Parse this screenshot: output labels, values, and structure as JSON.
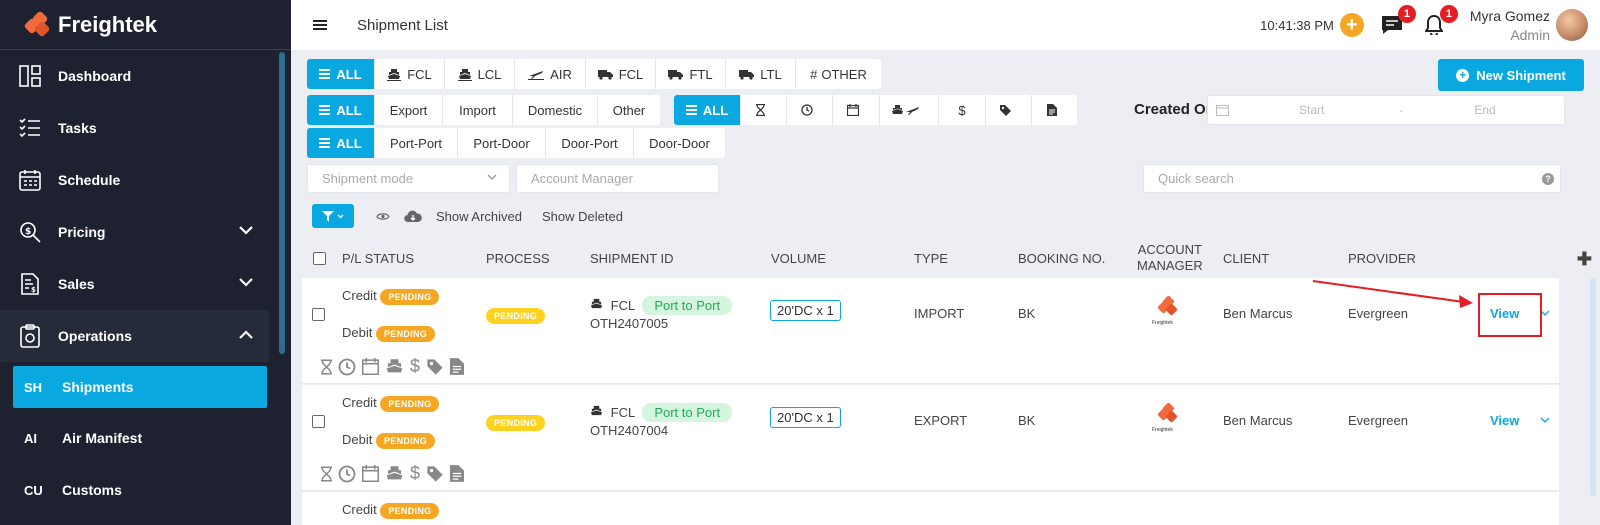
{
  "app": {
    "name": "Freightek",
    "page_title": "Shipment List"
  },
  "sidebar": {
    "items": [
      {
        "label": "Dashboard",
        "icon": "dashboard-icon"
      },
      {
        "label": "Tasks",
        "icon": "tasks-icon"
      },
      {
        "label": "Schedule",
        "icon": "calendar-icon"
      },
      {
        "label": "Pricing",
        "icon": "pricing-icon",
        "expandable": true
      },
      {
        "label": "Sales",
        "icon": "sales-icon",
        "expandable": true
      },
      {
        "label": "Operations",
        "icon": "clipboard-icon",
        "expanded": true
      }
    ],
    "sub_items": [
      {
        "abbr": "SH",
        "label": "Shipments",
        "active": true
      },
      {
        "abbr": "AI",
        "label": "Air Manifest"
      },
      {
        "abbr": "CU",
        "label": "Customs"
      }
    ]
  },
  "topbar": {
    "time": "10:41:38 PM",
    "messages_badge": "1",
    "notifications_badge": "1",
    "user_name": "Myra Gomez",
    "user_role": "Admin"
  },
  "filters": {
    "mode_all": "ALL",
    "modes": [
      "FCL",
      "LCL",
      "AIR",
      "FCL",
      "FTL",
      "LTL",
      "OTHER"
    ],
    "direction_all": "ALL",
    "directions": [
      "Export",
      "Import",
      "Domestic",
      "Other"
    ],
    "status_all": "ALL",
    "route_all": "ALL",
    "routes": [
      "Port-Port",
      "Port-Door",
      "Door-Port",
      "Door-Door"
    ],
    "new_shipment": "New Shipment",
    "created_on_label": "Created On:",
    "start_placeholder": "Start",
    "range_sep": "-",
    "end_placeholder": "End",
    "shipment_mode_placeholder": "Shipment mode",
    "account_manager_placeholder": "Account Manager",
    "quick_search_placeholder": "Quick search",
    "show_archived": "Show Archived",
    "show_deleted": "Show Deleted"
  },
  "table": {
    "headers": {
      "pl_status": "P/L STATUS",
      "process": "PROCESS",
      "shipment_id": "SHIPMENT ID",
      "volume": "VOLUME",
      "type": "TYPE",
      "booking_no": "BOOKING NO.",
      "account_manager_1": "ACCOUNT",
      "account_manager_2": "MANAGER",
      "client": "CLIENT",
      "provider": "PROVIDER"
    },
    "rows": [
      {
        "credit_label": "Credit",
        "credit_status": "PENDING",
        "debit_label": "Debit",
        "debit_status": "PENDING",
        "process": "PENDING",
        "mode": "FCL",
        "route": "Port to Port",
        "id": "OTH2407005",
        "volume": "20'DC x 1",
        "type": "IMPORT",
        "booking": "BK",
        "client": "Ben Marcus",
        "provider": "Evergreen",
        "action": "View"
      },
      {
        "credit_label": "Credit",
        "credit_status": "PENDING",
        "debit_label": "Debit",
        "debit_status": "PENDING",
        "process": "PENDING",
        "mode": "FCL",
        "route": "Port to Port",
        "id": "OTH2407004",
        "volume": "20'DC x 1",
        "type": "EXPORT",
        "booking": "BK",
        "client": "Ben Marcus",
        "provider": "Evergreen",
        "action": "View"
      },
      {
        "credit_label": "Credit",
        "credit_status": "PENDING"
      }
    ],
    "mini_logo_text": "Freightek"
  },
  "colors": {
    "accent": "#0aa8e0",
    "pending": "#f5a623",
    "sidebar": "#1e2230",
    "highlight": "#e31e24"
  }
}
